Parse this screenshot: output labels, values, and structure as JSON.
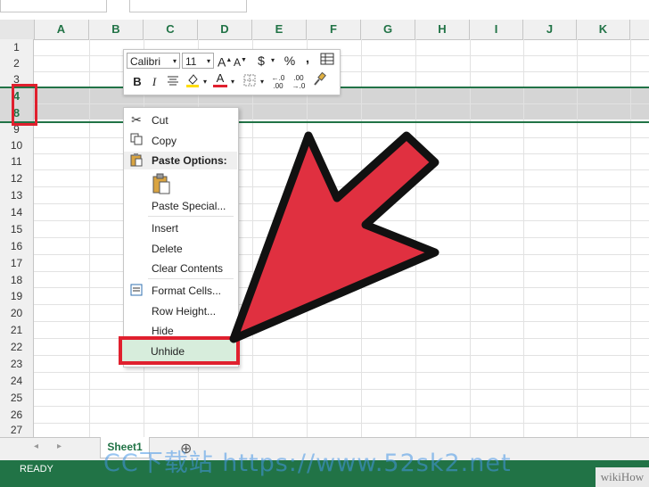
{
  "columns": [
    "A",
    "B",
    "C",
    "D",
    "E",
    "F",
    "G",
    "H",
    "I",
    "J",
    "K"
  ],
  "rows": [
    "1",
    "2",
    "3",
    "4",
    "8",
    "9",
    "10",
    "11",
    "12",
    "13",
    "14",
    "15",
    "16",
    "17",
    "18",
    "19",
    "20",
    "21",
    "22",
    "23",
    "24",
    "25",
    "26",
    "27"
  ],
  "selected_rows": [
    "4",
    "8"
  ],
  "mini_toolbar": {
    "font_name": "Calibri",
    "font_size": "11",
    "grow_font": "A",
    "shrink_font": "A",
    "currency": "$",
    "percent": "%",
    "comma": ",",
    "bold": "B",
    "italic": "I",
    "font_color": "A",
    "increase_decimal": ".00",
    "decrease_decimal": ".0"
  },
  "context_menu": {
    "cut": "Cut",
    "copy": "Copy",
    "paste_options": "Paste Options:",
    "paste_special": "Paste Special...",
    "insert": "Insert",
    "delete": "Delete",
    "clear_contents": "Clear Contents",
    "format_cells": "Format Cells...",
    "row_height": "Row Height...",
    "hide": "Hide",
    "unhide": "Unhide"
  },
  "sheet_tabs": [
    "Sheet1"
  ],
  "add_sheet": "⊕",
  "status": "READY",
  "watermark": "CC下载站 https://www.52sk2.net",
  "branding": "wikiHow",
  "colors": {
    "accent": "#217346",
    "highlight": "#e0202e",
    "arrow": "#e03040"
  }
}
